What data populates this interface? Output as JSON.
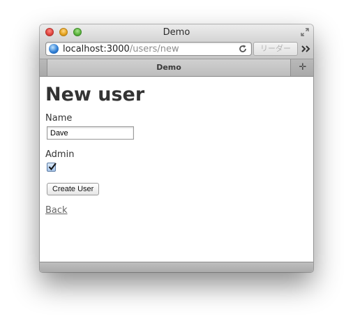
{
  "window": {
    "title": "Demo"
  },
  "toolbar": {
    "url_host": "localhost:3000",
    "url_path": "/users/new",
    "reader_label": "リーダー"
  },
  "tabs": [
    {
      "label": "Demo"
    }
  ],
  "page": {
    "title": "New user",
    "name_label": "Name",
    "name_value": "Dave",
    "admin_label": "Admin",
    "admin_checked": true,
    "submit_label": "Create User",
    "back_link": "Back"
  },
  "icons": [
    "globe-icon",
    "reload-icon",
    "overflow-chevrons-icon",
    "fullscreen-icon",
    "new-tab-plus-icon",
    "checkmark-icon"
  ]
}
